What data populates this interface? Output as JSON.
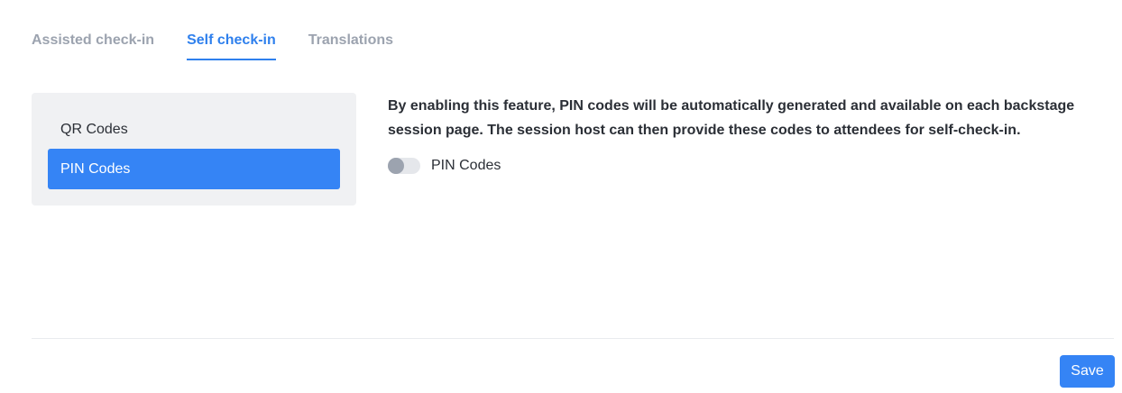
{
  "tabs": [
    {
      "label": "Assisted check-in",
      "active": false
    },
    {
      "label": "Self check-in",
      "active": true
    },
    {
      "label": "Translations",
      "active": false
    }
  ],
  "menu": {
    "items": [
      {
        "label": "QR Codes",
        "active": false
      },
      {
        "label": "PIN Codes",
        "active": true
      }
    ]
  },
  "content": {
    "description": "By enabling this feature, PIN codes will be automatically generated and available on each backstage session page. The session host can then provide these codes to attendees for self-check-in.",
    "toggle": {
      "label": "PIN Codes",
      "enabled": false
    }
  },
  "footer": {
    "save_label": "Save"
  },
  "colors": {
    "accent": "#3584f5",
    "tab_active": "#2f80ed",
    "tab_inactive": "#9ca3af"
  }
}
